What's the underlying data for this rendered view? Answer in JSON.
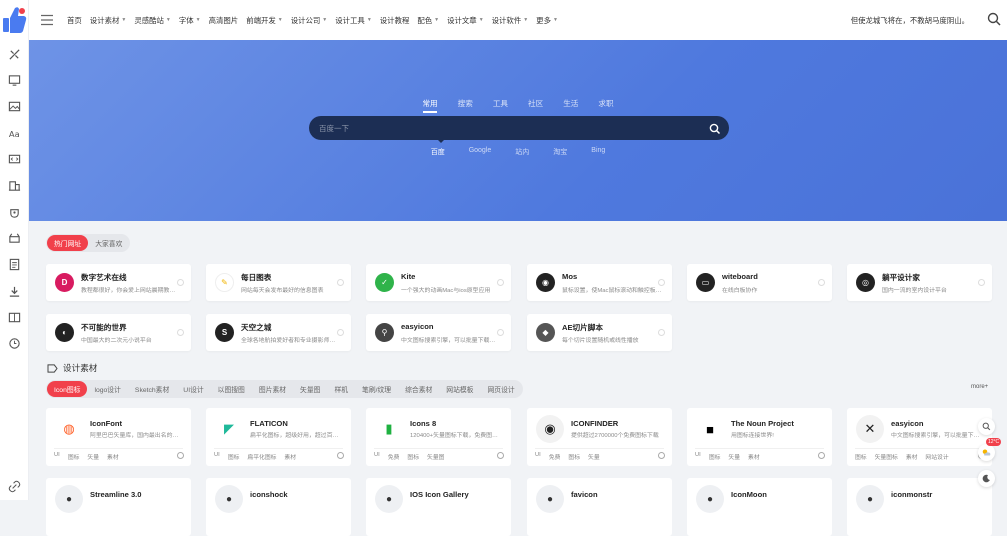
{
  "nav": [
    "首页",
    "设计素材",
    "灵感酷站",
    "字体",
    "高清图片",
    "前端开发",
    "设计公司",
    "设计工具",
    "设计教程",
    "配色",
    "设计文章",
    "设计软件",
    "更多"
  ],
  "nav_caret": [
    false,
    true,
    true,
    true,
    false,
    true,
    true,
    true,
    false,
    true,
    true,
    true,
    true
  ],
  "motto": "但使龙城飞将在，不教胡马度阴山。",
  "search": {
    "tabs": [
      "常用",
      "搜索",
      "工具",
      "社区",
      "生活",
      "求职"
    ],
    "placeholder": "百度一下",
    "engines": [
      "百度",
      "Google",
      "站内",
      "淘宝",
      "Bing"
    ]
  },
  "hot": {
    "tabs": [
      "热门网址",
      "大家喜欢"
    ],
    "cards": [
      {
        "title": "数字艺术在线",
        "desc": "教程都很好，你会爱上网站晨期教程的",
        "color": "#d81b60"
      },
      {
        "title": "每日图表",
        "desc": "网站每天会发布最好的信息图表",
        "color": "#f1b400"
      },
      {
        "title": "Kite",
        "desc": "一个强大的动画Mac与ios原型应用",
        "color": "#2fb34a"
      },
      {
        "title": "Mos",
        "desc": "鼠标设置，使Mac鼠标滚动和触控板一样顺滑",
        "color": "#222222"
      },
      {
        "title": "witeboard",
        "desc": "在线白板协作",
        "color": "#222222"
      },
      {
        "title": "躺平设计家",
        "desc": "国内一流的室内设计平台",
        "color": "#222222"
      },
      {
        "title": "不可能的世界",
        "desc": "中国最大的二次元小说平台",
        "color": "#222222"
      },
      {
        "title": "天空之城",
        "desc": "全球各地航拍爱好者和专业摄影师的聚集地",
        "color": "#222222"
      },
      {
        "title": "easyicon",
        "desc": "中文图标搜索引擎，可以批量下载图标",
        "color": "#444444"
      },
      {
        "title": "AE切片脚本",
        "desc": "每个切片设置随机或线性播放",
        "color": "#555555"
      }
    ]
  },
  "section": {
    "title": "设计素材",
    "tabs": [
      "Icon图标",
      "logo设计",
      "Sketch素材",
      "UI设计",
      "以图搜图",
      "图片素材",
      "矢量图",
      "样机",
      "笔刷/纹理",
      "综合素材",
      "网站模板",
      "网页设计"
    ],
    "more": "more+",
    "cards": [
      {
        "title": "IconFont",
        "desc": "阿里巴巴矢量库，国内最出名的矢量图标库",
        "tags": [
          "UI",
          "图标",
          "矢量",
          "素材"
        ],
        "color": "#ff5a1f"
      },
      {
        "title": "FLATICON",
        "desc": "扁平化图标，超级好用，超过百万的图标",
        "tags": [
          "UI",
          "图标",
          "扁平化图标",
          "素材"
        ],
        "color": "#1fb99a"
      },
      {
        "title": "Icons 8",
        "desc": "120400+矢量图标下载，免费图标素材库",
        "tags": [
          "UI",
          "免费",
          "图标",
          "矢量图"
        ],
        "color": "#1fb141"
      },
      {
        "title": "ICONFINDER",
        "desc": "提供超过2700000个免费图标下载",
        "tags": [
          "UI",
          "免费",
          "图标",
          "矢量"
        ],
        "color": "#ffffff"
      },
      {
        "title": "The Noun Project",
        "desc": "用图标连接世界!",
        "tags": [
          "UI",
          "图标",
          "矢量",
          "素材"
        ],
        "color": "#000000"
      },
      {
        "title": "easyicon",
        "desc": "中文图标搜索引擎，可以批量下载图标",
        "tags": [
          "图标",
          "矢量图标",
          "素材",
          "网站设计"
        ],
        "color": "#ffffff"
      }
    ],
    "row2": [
      "Streamline 3.0",
      "iconshock",
      "IOS Icon Gallery",
      "favicon",
      "IconMoon",
      "iconmonstr"
    ]
  },
  "weather": "12°C"
}
